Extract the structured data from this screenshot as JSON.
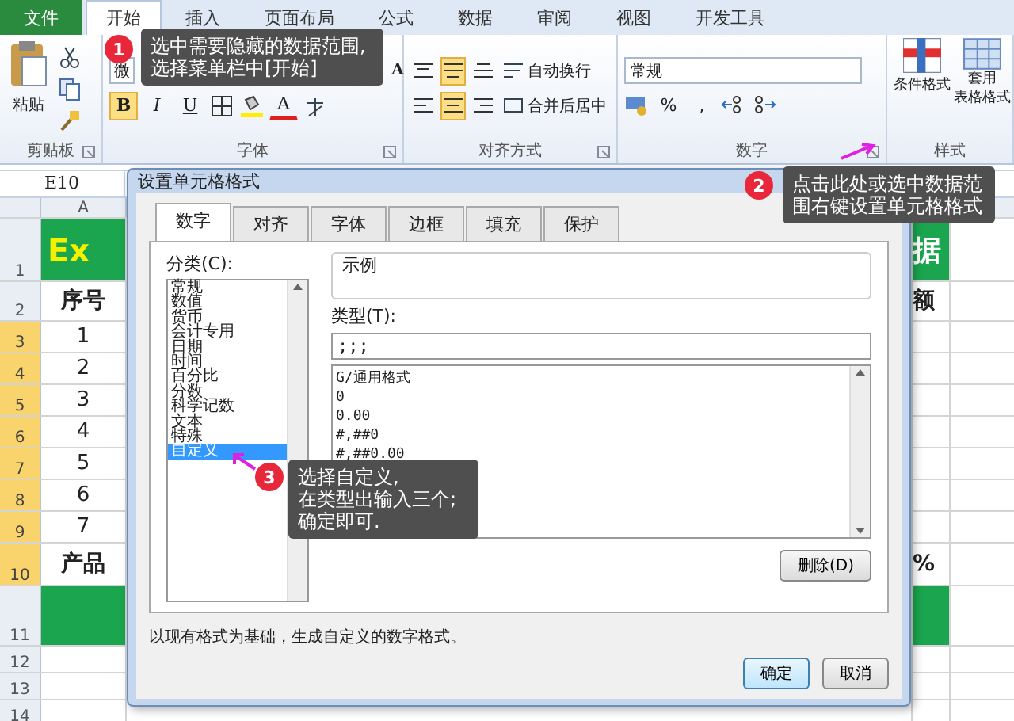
{
  "menu_tabs": [
    {
      "label": "文件",
      "kind": "file",
      "selected": false
    },
    {
      "label": "开始",
      "kind": "tab",
      "selected": true
    },
    {
      "label": "插入",
      "kind": "tab",
      "selected": false
    },
    {
      "label": "页面布局",
      "kind": "tab",
      "selected": false
    },
    {
      "label": "公式",
      "kind": "tab",
      "selected": false
    },
    {
      "label": "数据",
      "kind": "tab",
      "selected": false
    },
    {
      "label": "审阅",
      "kind": "tab",
      "selected": false
    },
    {
      "label": "视图",
      "kind": "tab",
      "selected": false
    },
    {
      "label": "开发工具",
      "kind": "tab",
      "selected": false
    }
  ],
  "ribbon": {
    "groups": [
      {
        "kind": "clipboard",
        "label": "剪贴板",
        "paste": "粘贴"
      },
      {
        "kind": "font",
        "label": "字体",
        "font_name": "微",
        "shrink": "A",
        "font_color": "A",
        "format_buttons": [
          {
            "label": "B",
            "kind": "bold",
            "on": true
          },
          {
            "label": "I",
            "kind": "italic",
            "on": false
          },
          {
            "label": "U",
            "kind": "underline",
            "on": false
          }
        ]
      },
      {
        "kind": "alignment",
        "label": "对齐方式",
        "wrap": "自动换行",
        "merge": "合并后居中",
        "vertical_align": [
          {
            "selected": false
          },
          {
            "selected": true
          },
          {
            "selected": false
          }
        ],
        "horizontal_align": [
          {
            "selected": false
          },
          {
            "selected": true
          },
          {
            "selected": false
          }
        ]
      },
      {
        "kind": "number",
        "label": "数字",
        "format": "常规",
        "percent": "%",
        "comma": ","
      },
      {
        "kind": "styles",
        "label": "样式",
        "conditional": "条件格式",
        "table_lines": [
          "套用",
          "表格格式"
        ]
      }
    ]
  },
  "name_box": "E10",
  "sheet": {
    "column_header": "A",
    "rows": [
      {
        "header": "1",
        "selected": false,
        "kind": "title",
        "a": "Ex",
        "right": "据"
      },
      {
        "header": "2",
        "selected": false,
        "kind": "heading",
        "a": "序号",
        "right": "额"
      },
      {
        "header": "3",
        "selected": true,
        "kind": "data",
        "a": "1",
        "right": ""
      },
      {
        "header": "4",
        "selected": true,
        "kind": "data",
        "a": "2",
        "right": ""
      },
      {
        "header": "5",
        "selected": true,
        "kind": "data",
        "a": "3",
        "right": ""
      },
      {
        "header": "6",
        "selected": true,
        "kind": "data",
        "a": "4",
        "right": ""
      },
      {
        "header": "7",
        "selected": true,
        "kind": "data",
        "a": "5",
        "right": ""
      },
      {
        "header": "8",
        "selected": true,
        "kind": "data",
        "a": "6",
        "right": ""
      },
      {
        "header": "9",
        "selected": true,
        "kind": "data",
        "a": "7",
        "right": ""
      },
      {
        "header": "10",
        "selected": true,
        "kind": "heading",
        "a": "产品",
        "right": "%"
      },
      {
        "header": "11",
        "selected": false,
        "kind": "band",
        "a": "",
        "right": ""
      },
      {
        "header": "12",
        "selected": false,
        "kind": "blank",
        "a": "",
        "right": ""
      },
      {
        "header": "13",
        "selected": false,
        "kind": "blank",
        "a": "",
        "right": ""
      },
      {
        "header": "14",
        "selected": false,
        "kind": "blank",
        "a": "",
        "right": ""
      }
    ]
  },
  "dialog": {
    "title": "设置单元格格式",
    "tabs": [
      {
        "label": "数字",
        "selected": true
      },
      {
        "label": "对齐",
        "selected": false
      },
      {
        "label": "字体",
        "selected": false
      },
      {
        "label": "边框",
        "selected": false
      },
      {
        "label": "填充",
        "selected": false
      },
      {
        "label": "保护",
        "selected": false
      }
    ],
    "category_label": "分类(C):",
    "categories": [
      {
        "label": "常规",
        "selected": false
      },
      {
        "label": "数值",
        "selected": false
      },
      {
        "label": "货币",
        "selected": false
      },
      {
        "label": "会计专用",
        "selected": false
      },
      {
        "label": "日期",
        "selected": false
      },
      {
        "label": "时间",
        "selected": false
      },
      {
        "label": "百分比",
        "selected": false
      },
      {
        "label": "分数",
        "selected": false
      },
      {
        "label": "科学记数",
        "selected": false
      },
      {
        "label": "文本",
        "selected": false
      },
      {
        "label": "特殊",
        "selected": false
      },
      {
        "label": "自定义",
        "selected": true
      }
    ],
    "sample_label": "示例",
    "type_label": "类型(T):",
    "type_value": ";;;",
    "formats": [
      "G/通用格式",
      "0",
      "0.00",
      "#,##0",
      "#,##0.00"
    ],
    "delete_button": "删除(D)",
    "description": "以现有格式为基础，生成自定义的数字格式。",
    "ok": "确定",
    "cancel": "取消"
  },
  "callouts": [
    {
      "number": "1",
      "text": "选中需要隐藏的数据范围,\n选择菜单栏中[开始]"
    },
    {
      "number": "2",
      "text": "点击此处或选中数据范围右键设置单元格格式"
    },
    {
      "number": "3",
      "text": "选择自定义,\n在类型出输入三个;\n确定即可."
    }
  ]
}
